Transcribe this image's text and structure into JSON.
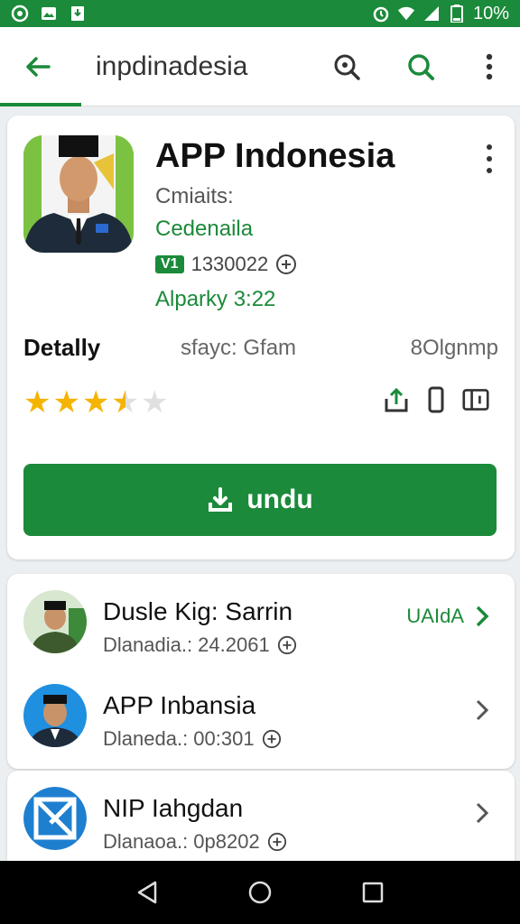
{
  "status_bar": {
    "battery_text": "10%",
    "icons_left": [
      "record-icon",
      "image-icon",
      "download-icon"
    ],
    "icons_right": [
      "alarm-icon",
      "wifi-icon",
      "signal-icon",
      "battery-icon"
    ]
  },
  "app_bar": {
    "title": "inpdinadesia"
  },
  "app": {
    "name": "APP Indonesia",
    "line1": "Cmiaits:",
    "line2": "Cedenaila",
    "version_badge": "V1",
    "version_number": "1330022",
    "line4": "Alparky 3:22",
    "detail_label": "Detally",
    "detail_mid": "sfayc: Gfam",
    "detail_right": "8Olgnmp",
    "rating": 3.5,
    "rating_max": 5,
    "install_label": "undu",
    "accent_color": "#1b8a3a",
    "star_color": "#f5b400"
  },
  "list": [
    {
      "title": "Dusle Kig: Sarrin",
      "subtitle": "Dlanadia.: 24.2061",
      "action": "UAIdA"
    },
    {
      "title": "APP Inbansia",
      "subtitle": "Dlaneda.: 00:301",
      "action": ""
    },
    {
      "title": "NIP Iahgdan",
      "subtitle": "Dlanaoa.: 0p8202",
      "action": ""
    }
  ]
}
